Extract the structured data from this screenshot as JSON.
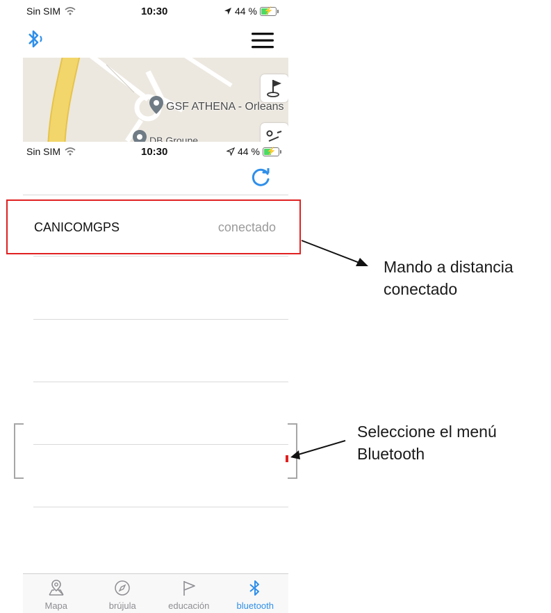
{
  "status_bar_top": {
    "carrier": "Sin SIM",
    "time": "10:30",
    "battery": "44 %",
    "battery_level": 0.44
  },
  "status_bar_second": {
    "carrier": "Sin SIM",
    "time": "10:30",
    "battery": "44 %",
    "battery_level": 0.44
  },
  "header": {
    "bluetooth_icon": "bluetooth-icon",
    "menu_icon": "hamburger-menu-icon"
  },
  "map": {
    "poi_main": "GSF ATHENA - Orleans",
    "poi_secondary": "DB Groupe",
    "side_buttons": [
      "flag-icon",
      "route-icon"
    ]
  },
  "bluetooth_page": {
    "refresh_icon": "refresh-icon",
    "device": {
      "name": "CANICOMGPS",
      "status": "conectado"
    }
  },
  "tabs": [
    {
      "label": "Mapa",
      "icon": "map-pin-icon"
    },
    {
      "label": "brújula",
      "icon": "compass-icon"
    },
    {
      "label": "educación",
      "icon": "flag-icon"
    },
    {
      "label": "bluetooth",
      "icon": "bluetooth-icon",
      "active": true
    }
  ],
  "annotations": {
    "callout_1_line1": "Mando a distancia",
    "callout_1_line2": "conectado",
    "callout_2_line1": "Seleccione el menú",
    "callout_2_line2": "Bluetooth"
  },
  "colors": {
    "accent": "#2f8fea",
    "highlight_box": "#e02020",
    "map_road": "#f2d66b"
  }
}
